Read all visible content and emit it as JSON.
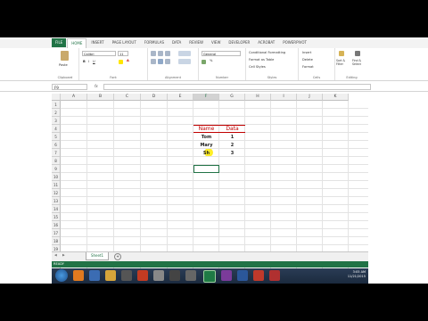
{
  "ribbon_tabs": [
    "FILE",
    "HOME",
    "INSERT",
    "PAGE LAYOUT",
    "FORMULAS",
    "DATA",
    "REVIEW",
    "VIEW",
    "DEVELOPER",
    "ACROBAT",
    "POWERPIVOT"
  ],
  "active_tab": "HOME",
  "clipboard": {
    "paste": "Paste",
    "label": "Clipboard"
  },
  "font": {
    "name": "Calibri",
    "size": "11",
    "label": "Font"
  },
  "alignment": {
    "label": "Alignment"
  },
  "number": {
    "format": "General",
    "label": "Number"
  },
  "styles": {
    "cond": "Conditional Formatting",
    "table": "Format as Table",
    "cell": "Cell Styles",
    "label": "Styles"
  },
  "cells": {
    "insert": "Insert",
    "delete": "Delete",
    "format": "Format",
    "label": "Cells"
  },
  "editing": {
    "sort": "Sort & Filter",
    "find": "Find & Select",
    "label": "Editing"
  },
  "name_box": "F9",
  "fx": "fx",
  "columns": [
    "A",
    "B",
    "C",
    "D",
    "E",
    "F",
    "G",
    "H",
    "I",
    "J",
    "K"
  ],
  "selected_column": "F",
  "rows": [
    "1",
    "2",
    "3",
    "4",
    "5",
    "6",
    "7",
    "8",
    "9",
    "10",
    "11",
    "12",
    "13",
    "14",
    "15",
    "16",
    "17",
    "18",
    "19",
    "20",
    "21"
  ],
  "table": {
    "headers": [
      "Name",
      "Data"
    ],
    "rows": [
      [
        "Tom",
        "1"
      ],
      [
        "Mary",
        "2"
      ],
      [
        "Sh",
        "3"
      ]
    ]
  },
  "sheet_tab": "Sheet1",
  "add_sheet": "+",
  "status": "READY",
  "clock": {
    "time": "3:05 AM",
    "date": "11/21/2015"
  },
  "accent_color": "#217346",
  "header_text_color": "#c00000"
}
